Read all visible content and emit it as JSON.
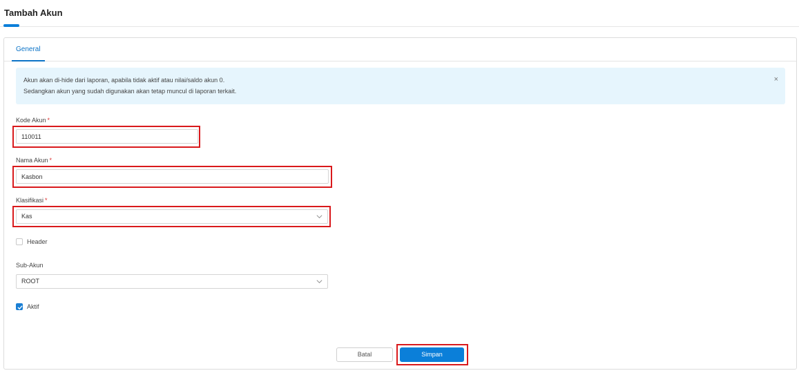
{
  "header": {
    "title": "Tambah Akun"
  },
  "tabs": [
    {
      "label": "General"
    }
  ],
  "alert": {
    "line1": "Akun akan di-hide dari laporan, apabila tidak aktif atau nilai/saldo akun 0.",
    "line2": "Sedangkan akun yang sudah digunakan akan tetap muncul di laporan terkait.",
    "close": "×"
  },
  "form": {
    "required_mark": "*",
    "kode_akun": {
      "label": "Kode Akun",
      "value": "110011"
    },
    "nama_akun": {
      "label": "Nama Akun",
      "value": "Kasbon"
    },
    "klasifikasi": {
      "label": "Klasifikasi",
      "value": "Kas"
    },
    "header_check": {
      "label": "Header",
      "checked": false
    },
    "sub_akun": {
      "label": "Sub-Akun",
      "value": "ROOT"
    },
    "aktif_check": {
      "label": "Aktif",
      "checked": true
    }
  },
  "actions": {
    "cancel_label": "Batal",
    "save_label": "Simpan"
  },
  "colors": {
    "accent": "#0b7fd9",
    "highlight": "#d9191c",
    "alert_bg": "#e6f5fd"
  }
}
